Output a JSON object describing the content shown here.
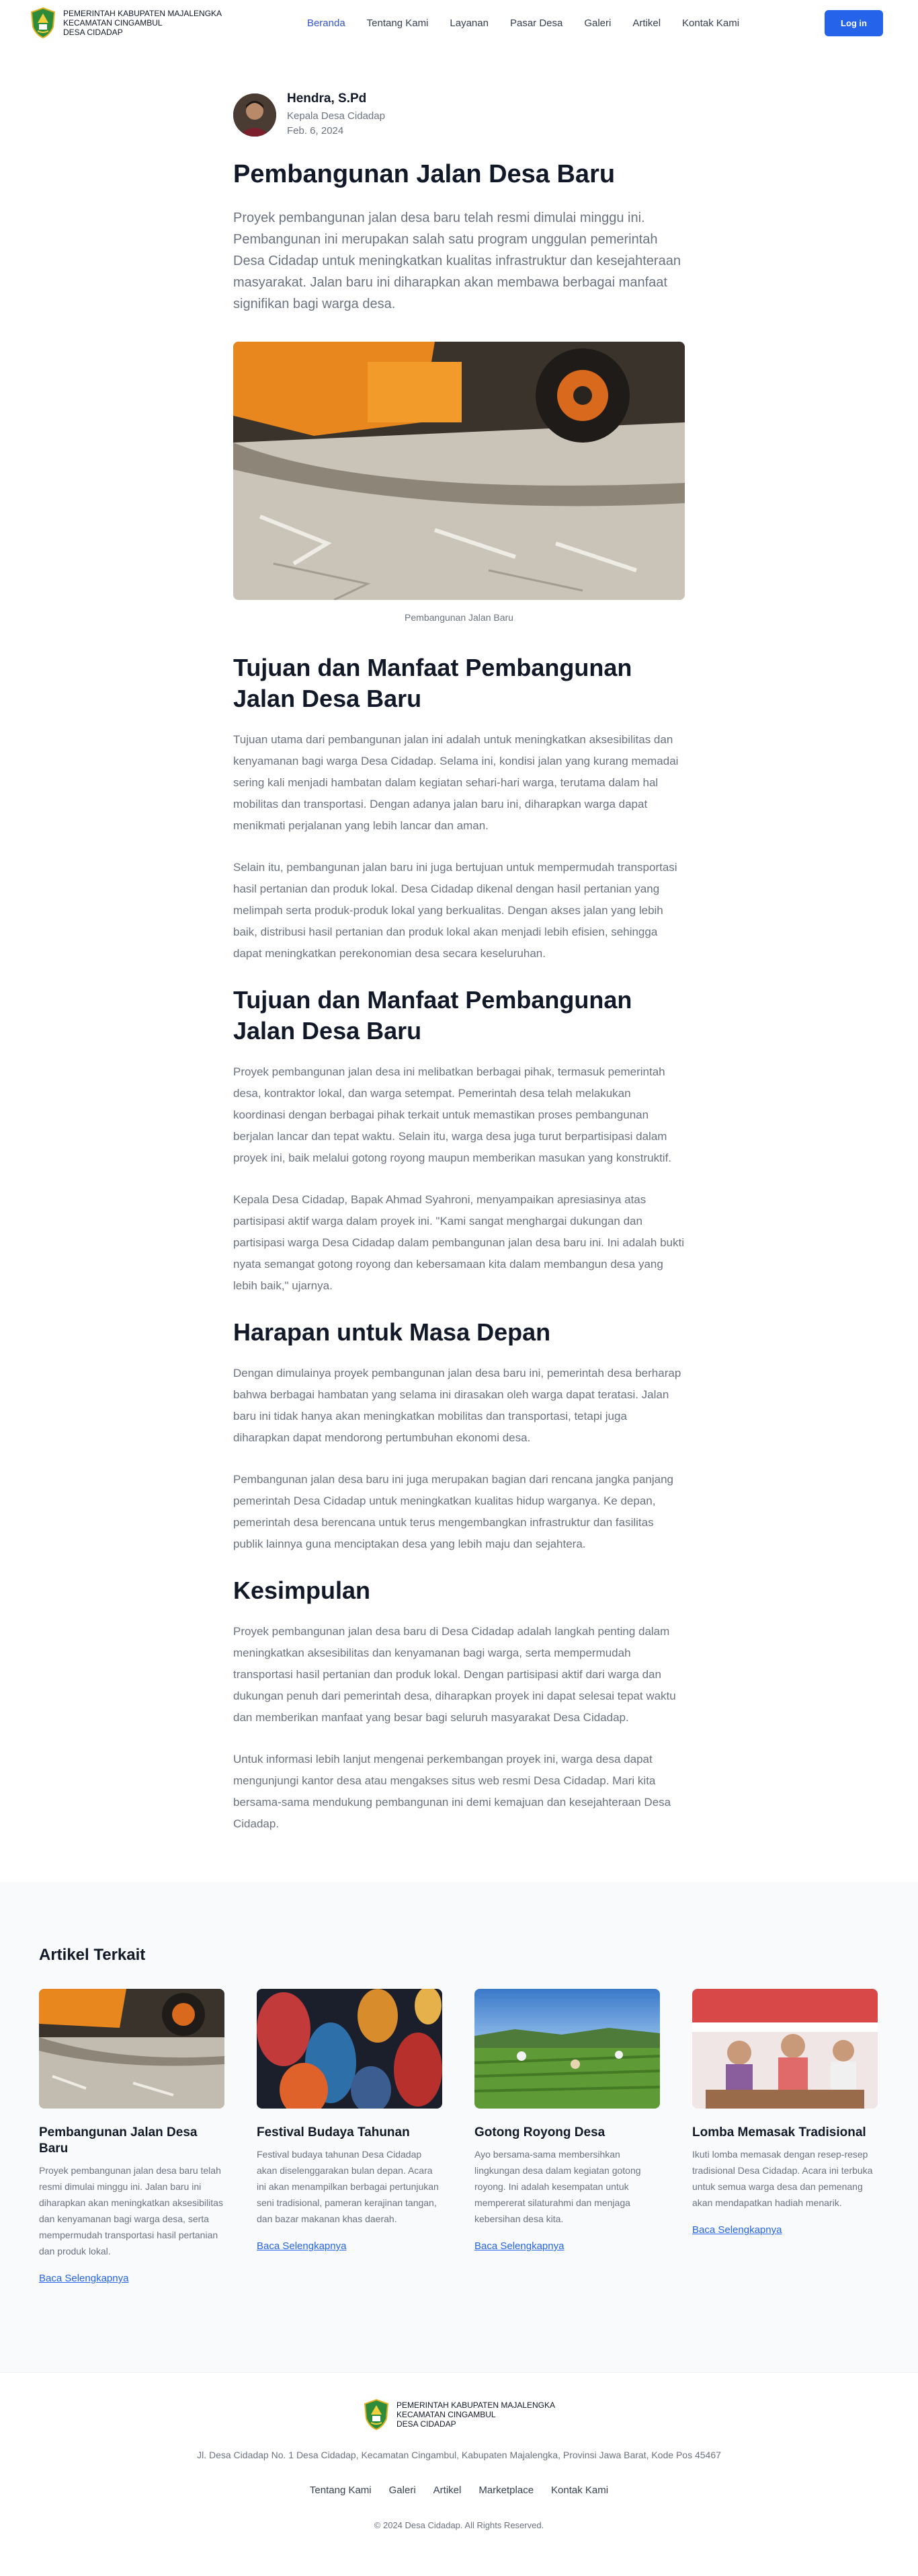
{
  "header": {
    "brand_lines": [
      "PEMERINTAH KABUPATEN MAJALENGKA",
      "KECAMATAN CINGAMBUL",
      "DESA CIDADAP"
    ],
    "nav": [
      "Beranda",
      "Tentang Kami",
      "Layanan",
      "Pasar Desa",
      "Galeri",
      "Artikel",
      "Kontak Kami"
    ],
    "login_label": "Log in"
  },
  "article": {
    "author_name": "Hendra, S.Pd",
    "author_role": "Kepala Desa Cidadap",
    "date": "Feb. 6, 2024",
    "title": "Pembangunan Jalan Desa Baru",
    "lead": "Proyek pembangunan jalan desa baru telah resmi dimulai minggu ini. Pembangunan ini merupakan salah satu program unggulan pemerintah Desa Cidadap untuk meningkatkan kualitas infrastruktur dan kesejahteraan masyarakat. Jalan baru ini diharapkan akan membawa berbagai manfaat signifikan bagi warga desa.",
    "image_caption": "Pembangunan Jalan Baru",
    "sections": [
      {
        "heading": "Tujuan dan Manfaat Pembangunan Jalan Desa Baru",
        "paragraphs": [
          "Tujuan utama dari pembangunan jalan ini adalah untuk meningkatkan aksesibilitas dan kenyamanan bagi warga Desa Cidadap. Selama ini, kondisi jalan yang kurang memadai sering kali menjadi hambatan dalam kegiatan sehari-hari warga, terutama dalam hal mobilitas dan transportasi. Dengan adanya jalan baru ini, diharapkan warga dapat menikmati perjalanan yang lebih lancar dan aman.",
          "Selain itu, pembangunan jalan baru ini juga bertujuan untuk mempermudah transportasi hasil pertanian dan produk lokal. Desa Cidadap dikenal dengan hasil pertanian yang melimpah serta produk-produk lokal yang berkualitas. Dengan akses jalan yang lebih baik, distribusi hasil pertanian dan produk lokal akan menjadi lebih efisien, sehingga dapat meningkatkan perekonomian desa secara keseluruhan."
        ]
      },
      {
        "heading": "Tujuan dan Manfaat Pembangunan Jalan Desa Baru",
        "paragraphs": [
          "Proyek pembangunan jalan desa ini melibatkan berbagai pihak, termasuk pemerintah desa, kontraktor lokal, dan warga setempat. Pemerintah desa telah melakukan koordinasi dengan berbagai pihak terkait untuk memastikan proses pembangunan berjalan lancar dan tepat waktu. Selain itu, warga desa juga turut berpartisipasi dalam proyek ini, baik melalui gotong royong maupun memberikan masukan yang konstruktif.",
          "Kepala Desa Cidadap, Bapak Ahmad Syahroni, menyampaikan apresiasinya atas partisipasi aktif warga dalam proyek ini. \"Kami sangat menghargai dukungan dan partisipasi warga Desa Cidadap dalam pembangunan jalan desa baru ini. Ini adalah bukti nyata semangat gotong royong dan kebersamaan kita dalam membangun desa yang lebih baik,\" ujarnya."
        ]
      },
      {
        "heading": "Harapan untuk Masa Depan",
        "paragraphs": [
          "Dengan dimulainya proyek pembangunan jalan desa baru ini, pemerintah desa berharap bahwa berbagai hambatan yang selama ini dirasakan oleh warga dapat teratasi. Jalan baru ini tidak hanya akan meningkatkan mobilitas dan transportasi, tetapi juga diharapkan dapat mendorong pertumbuhan ekonomi desa.",
          "Pembangunan jalan desa baru ini juga merupakan bagian dari rencana jangka panjang pemerintah Desa Cidadap untuk meningkatkan kualitas hidup warganya. Ke depan, pemerintah desa berencana untuk terus mengembangkan infrastruktur dan fasilitas publik lainnya guna menciptakan desa yang lebih maju dan sejahtera."
        ]
      },
      {
        "heading": "Kesimpulan",
        "paragraphs": [
          "Proyek pembangunan jalan desa baru di Desa Cidadap adalah langkah penting dalam meningkatkan aksesibilitas dan kenyamanan bagi warga, serta mempermudah transportasi hasil pertanian dan produk lokal. Dengan partisipasi aktif dari warga dan dukungan penuh dari pemerintah desa, diharapkan proyek ini dapat selesai tepat waktu dan memberikan manfaat yang besar bagi seluruh masyarakat Desa Cidadap.",
          "Untuk informasi lebih lanjut mengenai perkembangan proyek ini, warga desa dapat mengunjungi kantor desa atau mengakses situs web resmi Desa Cidadap. Mari kita bersama-sama mendukung pembangunan ini demi kemajuan dan kesejahteraan Desa Cidadap."
        ]
      }
    ]
  },
  "related": {
    "heading": "Artikel Terkait",
    "cards": [
      {
        "title": "Pembangunan Jalan Desa Baru",
        "desc": "Proyek pembangunan jalan desa baru telah resmi dimulai minggu ini. Jalan baru ini diharapkan akan meningkatkan aksesibilitas dan kenyamanan bagi warga desa, serta mempermudah transportasi hasil pertanian dan produk lokal.",
        "link": "Baca Selengkapnya"
      },
      {
        "title": "Festival Budaya Tahunan",
        "desc": "Festival budaya tahunan Desa Cidadap akan diselenggarakan bulan depan. Acara ini akan menampilkan berbagai pertunjukan seni tradisional, pameran kerajinan tangan, dan bazar makanan khas daerah.",
        "link": "Baca Selengkapnya"
      },
      {
        "title": "Gotong Royong Desa",
        "desc": "Ayo bersama-sama membersihkan lingkungan desa dalam kegiatan gotong royong. Ini adalah kesempatan untuk mempererat silaturahmi dan menjaga kebersihan desa kita.",
        "link": "Baca Selengkapnya"
      },
      {
        "title": "Lomba Memasak Tradisional",
        "desc": "Ikuti lomba memasak dengan resep-resep tradisional Desa Cidadap. Acara ini terbuka untuk semua warga desa dan pemenang akan mendapatkan hadiah menarik.",
        "link": "Baca Selengkapnya"
      }
    ]
  },
  "footer": {
    "brand_lines": [
      "PEMERINTAH KABUPATEN MAJALENGKA",
      "KECAMATAN CINGAMBUL",
      "DESA CIDADAP"
    ],
    "address": "Jl. Desa Cidadap No. 1 Desa Cidadap, Kecamatan Cingambul, Kabupaten Majalengka, Provinsi Jawa Barat, Kode Pos 45467",
    "nav": [
      "Tentang Kami",
      "Galeri",
      "Artikel",
      "Marketplace",
      "Kontak Kami"
    ],
    "copyright": "© 2024 Desa Cidadap. All Rights Reserved."
  },
  "colors": {
    "accent": "#2563eb",
    "nav_active": "#3454d1",
    "muted_text": "#6b7280",
    "related_bg": "#f9fafb"
  },
  "icons": [
    "village-logo-icon",
    "author-avatar"
  ]
}
